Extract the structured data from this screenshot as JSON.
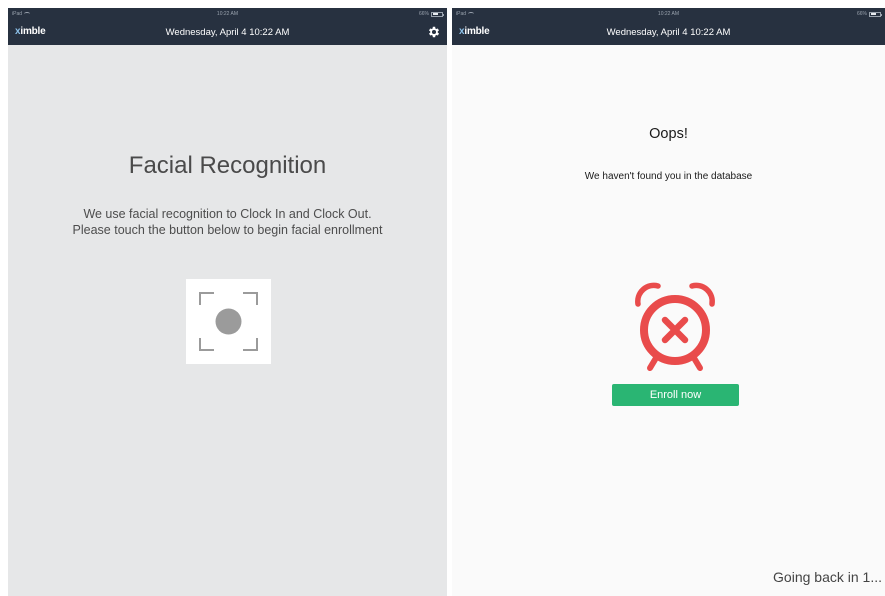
{
  "colors": {
    "header_bg": "#273140",
    "left_bg": "#e6e7e8",
    "right_bg": "#fafafa",
    "accent_green": "#2ab573",
    "alarm_red": "#e94b4b",
    "icon_gray": "#9b9b9b"
  },
  "left": {
    "status_bar": {
      "carrier": "iPad",
      "time": "10:22 AM",
      "battery": "66%"
    },
    "header": {
      "logo": "ximble",
      "date_time": "Wednesday, April 4  10:22 AM",
      "settings_icon": "gear-icon"
    },
    "title": "Facial Recognition",
    "description_line1": "We use facial recognition to Clock In and Clock Out.",
    "description_line2": "Please touch the button below to begin facial enrollment",
    "face_button_icon": "face-scan-icon"
  },
  "right": {
    "status_bar": {
      "carrier": "iPad",
      "time": "10:22 AM",
      "battery": "66%"
    },
    "header": {
      "logo": "ximble",
      "date_time": "Wednesday, April 4  10:22 AM"
    },
    "title": "Oops!",
    "message": "We haven't found you in the database",
    "alarm_icon": "alarm-clock-error-icon",
    "enroll_button": "Enroll now",
    "countdown": "Going back in 1..."
  }
}
